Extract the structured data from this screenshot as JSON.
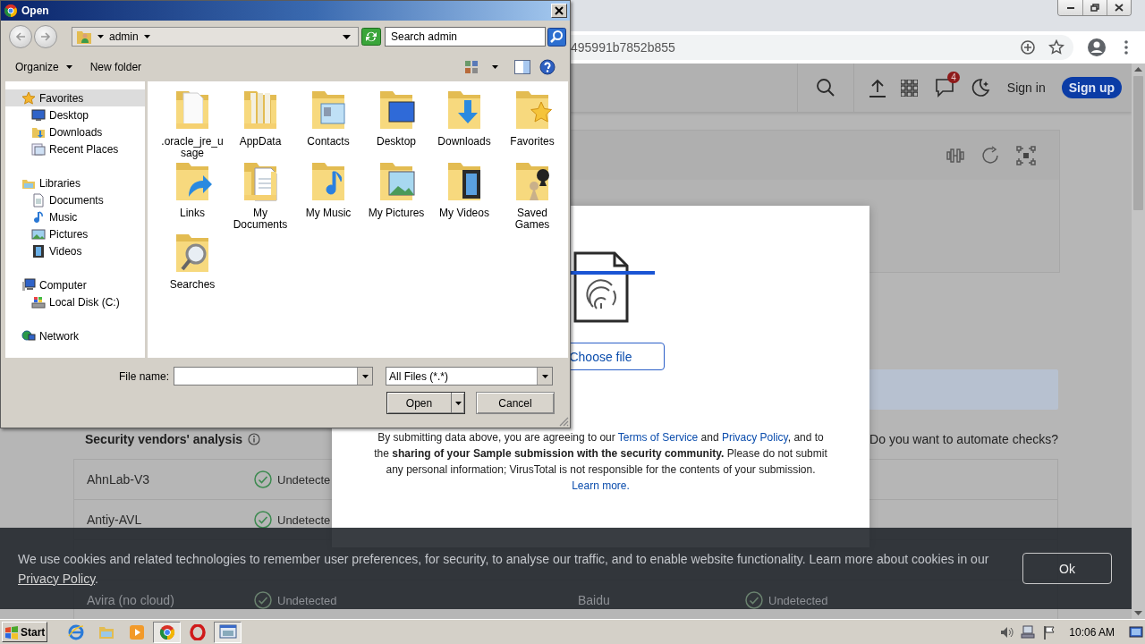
{
  "open_dialog": {
    "title": "Open",
    "location": "admin",
    "search_placeholder": "Search admin",
    "toolbar": [
      {
        "label": "Organize",
        "kind": "menu"
      },
      {
        "label": "New folder",
        "kind": "button"
      }
    ],
    "nav": [
      {
        "label": "Favorites",
        "kind": "star",
        "selected": true,
        "children": [
          {
            "label": "Desktop",
            "kind": "desktop",
            "selected": false
          },
          {
            "label": "Downloads",
            "kind": "download",
            "selected": false
          },
          {
            "label": "Recent Places",
            "kind": "recent",
            "selected": false
          }
        ]
      },
      {
        "label": "Libraries",
        "kind": "library",
        "selected": false,
        "children": [
          {
            "label": "Documents",
            "kind": "document",
            "selected": false
          },
          {
            "label": "Music",
            "kind": "music",
            "selected": false
          },
          {
            "label": "Pictures",
            "kind": "picture",
            "selected": false
          },
          {
            "label": "Videos",
            "kind": "video",
            "selected": false
          }
        ]
      },
      {
        "label": "Computer",
        "kind": "computer",
        "selected": false,
        "children": [
          {
            "label": "Local Disk (C:)",
            "kind": "disk",
            "selected": false
          }
        ]
      },
      {
        "label": "Network",
        "kind": "network",
        "selected": false
      }
    ],
    "files": [
      {
        "name": ".oracle_jre_usage",
        "kind": "blank"
      },
      {
        "name": "AppData",
        "kind": "papers"
      },
      {
        "name": "Contacts",
        "kind": "contact"
      },
      {
        "name": "Desktop",
        "kind": "desktop"
      },
      {
        "name": "Downloads",
        "kind": "download"
      },
      {
        "name": "Favorites",
        "kind": "star"
      },
      {
        "name": "Links",
        "kind": "link"
      },
      {
        "name": "My Documents",
        "kind": "document"
      },
      {
        "name": "My Music",
        "kind": "music"
      },
      {
        "name": "My Pictures",
        "kind": "picture"
      },
      {
        "name": "My Videos",
        "kind": "video"
      },
      {
        "name": "Saved Games",
        "kind": "games"
      },
      {
        "name": "Searches",
        "kind": "search"
      }
    ],
    "file_name_label": "File name:",
    "file_type": "All Files (*.*)",
    "buttons": [
      {
        "label": "Open",
        "kind": "split"
      },
      {
        "label": "Cancel",
        "kind": "plain"
      }
    ]
  },
  "browser": {
    "url": "495991b7852b855"
  },
  "site_header": {
    "notification_count": "4",
    "sign_in": "Sign in",
    "sign_up": "Sign up"
  },
  "analysis": {
    "title": "Security vendors' analysis",
    "automate_prompt": "Do you want to automate checks?",
    "rows": [
      {
        "cells": [
          {
            "vendor": "AhnLab-V3",
            "result": "Undetecte"
          }
        ]
      },
      {
        "cells": [
          {
            "vendor": "Antiy-AVL",
            "result": "Undetecte"
          }
        ]
      }
    ],
    "rows_under_banner": [
      {
        "cells": [
          {
            "vendor": "Avira (no cloud)",
            "result": "Undetected"
          },
          {
            "vendor": "Baidu",
            "result": "Undetected"
          }
        ]
      }
    ]
  },
  "upload_modal": {
    "choose_file": "Choose file",
    "terms": [
      {
        "kind": "text",
        "text": "By submitting data above, you are agreeing to our "
      },
      {
        "kind": "link",
        "text": "Terms of Service"
      },
      {
        "kind": "text",
        "text": " and "
      },
      {
        "kind": "link",
        "text": "Privacy Policy"
      },
      {
        "kind": "text",
        "text": ", and to the **sharing of your Sample submission with the security community.** Please do not submit any personal information; VirusTotal is not responsible for the contents of your submission."
      }
    ],
    "learn_more": "Learn more."
  },
  "cookie_banner": {
    "text": [
      {
        "kind": "text",
        "text": "We use cookies and related technologies to remember user preferences, for security, to analyse our traffic, and to enable website functionality. Learn more about cookies in our "
      },
      {
        "kind": "link",
        "text": "Privacy Policy"
      },
      {
        "kind": "text",
        "text": "."
      }
    ],
    "button": "Ok"
  },
  "taskbar": {
    "start": "Start",
    "clock": "10:06 AM",
    "apps": [
      {
        "kind": "globe",
        "running": false
      },
      {
        "kind": "folder",
        "running": false
      },
      {
        "kind": "player",
        "running": false
      },
      {
        "kind": "browser",
        "running": true
      },
      {
        "kind": "ring",
        "running": false
      },
      {
        "kind": "window",
        "running": true
      }
    ]
  }
}
